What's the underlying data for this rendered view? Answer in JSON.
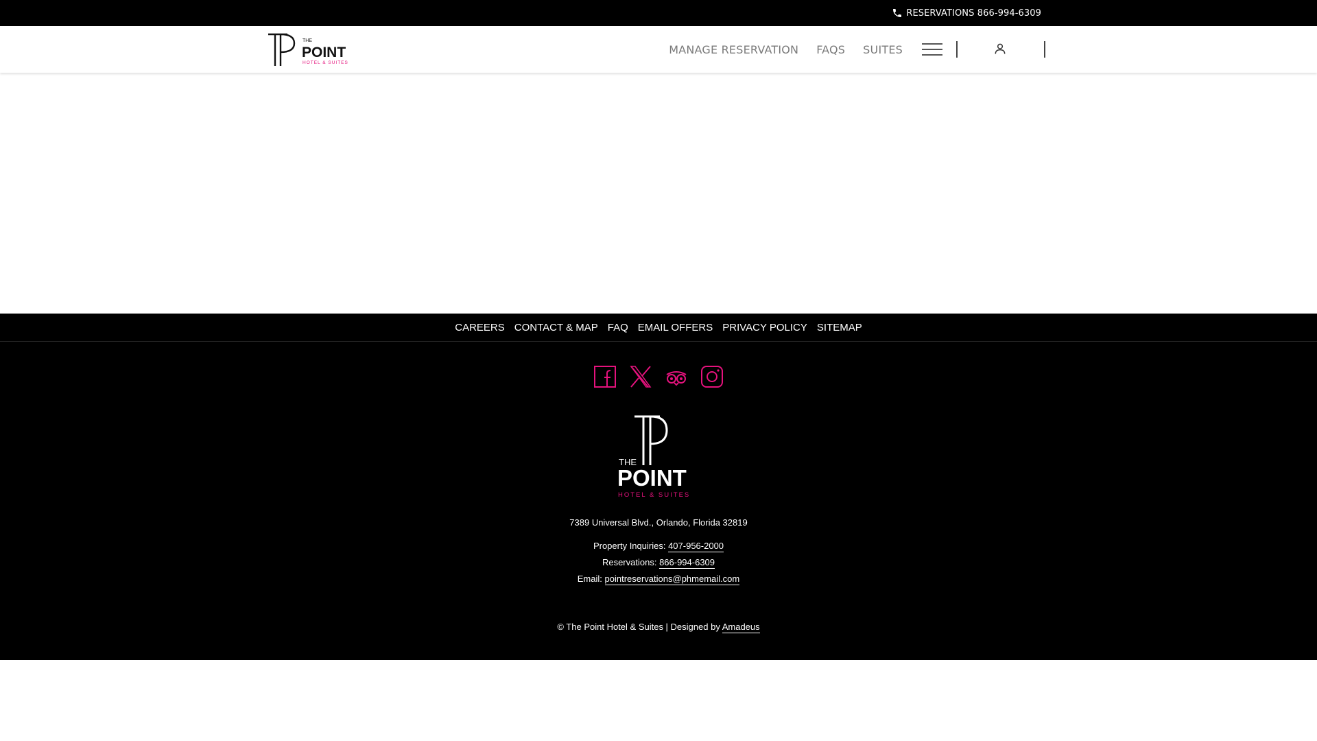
{
  "topbar": {
    "reservations_label": "RESERVATIONS 866-994-6309",
    "icon": "phone-icon"
  },
  "header": {
    "logo": {
      "the": "THE",
      "point": "POINT",
      "tagline": "HOTEL & SUITES"
    },
    "nav": [
      {
        "label": "MANAGE RESERVATION"
      },
      {
        "label": "FAQS"
      },
      {
        "label": "SUITES"
      }
    ],
    "menu_icon": "hamburger-menu-icon",
    "user_icon": "user-icon"
  },
  "footer_nav": [
    {
      "label": "CAREERS"
    },
    {
      "label": "CONTACT & MAP"
    },
    {
      "label": "FAQ"
    },
    {
      "label": "EMAIL OFFERS"
    },
    {
      "label": "PRIVACY POLICY"
    },
    {
      "label": "SITEMAP"
    }
  ],
  "footer": {
    "socials": [
      "facebook-icon",
      "x-twitter-icon",
      "tripadvisor-icon",
      "instagram-icon"
    ],
    "logo": {
      "the": "THE",
      "point": "POINT",
      "tagline": "HOTEL & SUITES"
    },
    "address": "7389 Universal Blvd., Orlando, Florida 32819",
    "property_label": "Property Inquiries:",
    "property_phone": "407-956-2000",
    "reservations_label": "Reservations:",
    "reservations_phone": "866-994-6309",
    "email_label": "Email:",
    "email": "pointreservations@phmemail.com",
    "copyright": "© The Point Hotel & Suites | Designed by",
    "designer": "Amadeus"
  },
  "colors": {
    "brand_pink": "#e5127d",
    "footer_bg": "#000000",
    "nav_text": "#7a7a7a"
  }
}
